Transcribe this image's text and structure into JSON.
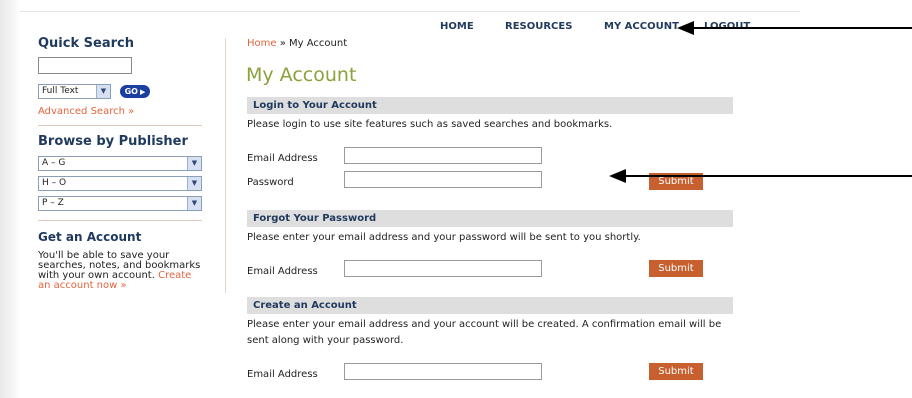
{
  "nav": {
    "home": "HOME",
    "resources": "RESOURCES",
    "my_account": "MY ACCOUNT",
    "logout": "LOGOUT"
  },
  "sidebar": {
    "quick_search": {
      "heading": "Quick Search",
      "search_value": "",
      "mode_selected": "Full Text",
      "go_label": "GO",
      "advanced_link": "Advanced Search »"
    },
    "browse": {
      "heading": "Browse by Publisher",
      "ranges": [
        "A – G",
        "H – O",
        "P – Z"
      ]
    },
    "get_account": {
      "heading": "Get an Account",
      "text": "You'll be able to save your searches, notes, and bookmarks with your own account. ",
      "link": "Create an account now »"
    }
  },
  "main": {
    "breadcrumb": {
      "home": "Home",
      "separator": " » ",
      "current": "My Account"
    },
    "title": "My Account",
    "login": {
      "heading": "Login to Your Account",
      "description": "Please login to use site features such as saved searches and bookmarks.",
      "email_label": "Email Address",
      "email_value": "",
      "password_label": "Password",
      "password_value": "",
      "submit_label": "Submit"
    },
    "forgot": {
      "heading": "Forgot Your Password",
      "description": "Please enter your email address and your password will be sent to you shortly.",
      "email_label": "Email Address",
      "email_value": "",
      "submit_label": "Submit"
    },
    "create": {
      "heading": "Create an Account",
      "description": "Please enter your email address and your account will be created. A confirmation email will be sent along with your password.",
      "email_label": "Email Address",
      "email_value": "",
      "submit_label": "Submit"
    }
  },
  "annotations": {
    "arrow_color": "#000000"
  },
  "colors": {
    "heading_navy": "#1f3a5c",
    "link_orange": "#e2643e",
    "title_green": "#8aa13c",
    "submit_rust": "#c85f2f",
    "go_blue": "#1b3fa0",
    "section_gray": "#dedede"
  },
  "icons": {
    "select_arrow": "chevron-down-icon",
    "go_arrow": "play-icon"
  }
}
